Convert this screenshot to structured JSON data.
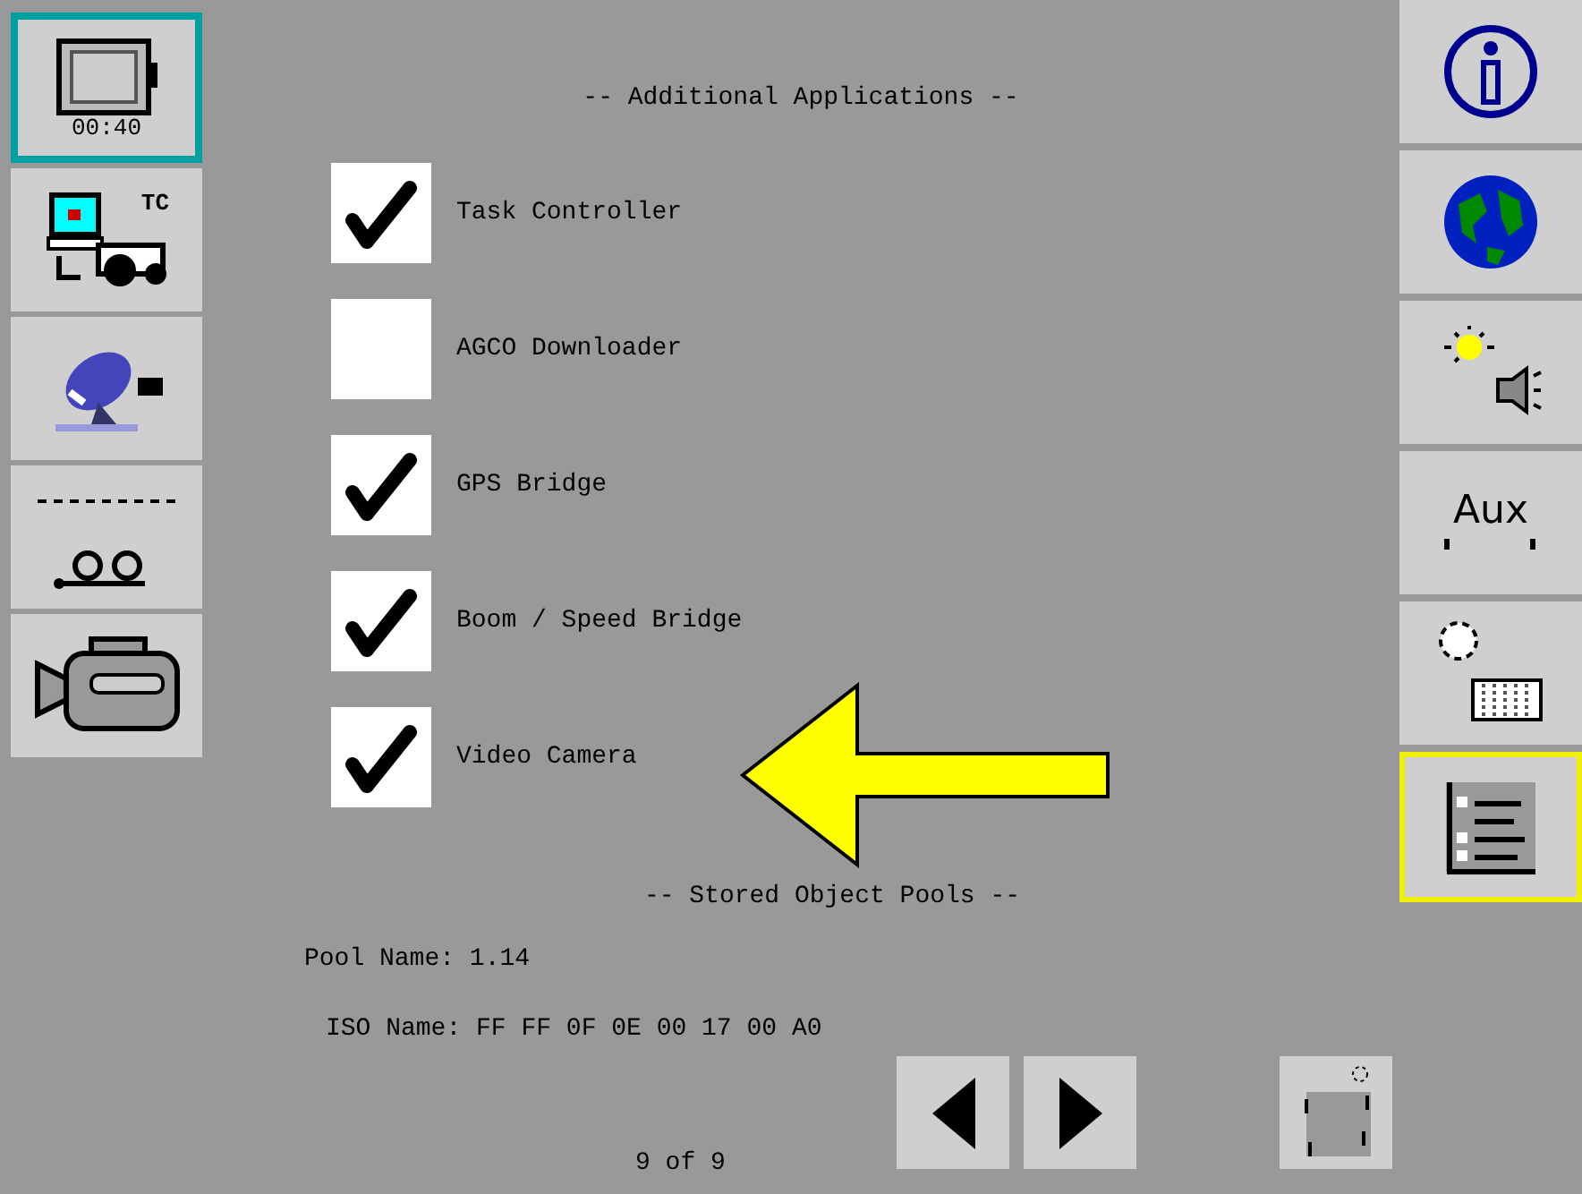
{
  "left_softkeys": [
    {
      "kind": "timer",
      "label": "00:40",
      "selected": true
    },
    {
      "kind": "tractor",
      "label": "TC",
      "selected": false
    },
    {
      "kind": "dish",
      "selected": false
    },
    {
      "kind": "implement",
      "selected": false
    },
    {
      "kind": "camera",
      "selected": false
    }
  ],
  "heading": "-- Additional Applications --",
  "applications": [
    {
      "label": "Task Controller",
      "checked": true
    },
    {
      "label": "AGCO Downloader",
      "checked": false
    },
    {
      "label": "GPS Bridge",
      "checked": true
    },
    {
      "label": "Boom / Speed Bridge",
      "checked": true
    },
    {
      "label": "Video Camera",
      "checked": true
    }
  ],
  "pools_heading": "-- Stored Object Pools --",
  "pool_name": "Pool Name: 1.14",
  "iso_name": "ISO Name: FF FF 0F 0E 00 17 00 A0",
  "page": "9 of 9",
  "right_softkeys": [
    {
      "kind": "info",
      "selected": false
    },
    {
      "kind": "globe",
      "selected": false
    },
    {
      "kind": "light-sound",
      "selected": false
    },
    {
      "kind": "aux",
      "label": "Aux",
      "selected": false
    },
    {
      "kind": "gauge",
      "selected": false
    },
    {
      "kind": "list",
      "selected": true
    }
  ]
}
